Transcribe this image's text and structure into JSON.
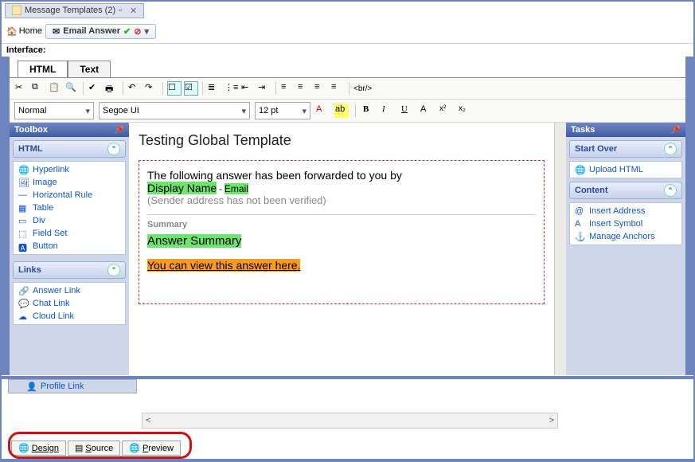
{
  "window": {
    "title": "Message Templates (2)",
    "home": "Home",
    "email_answer": "Email Answer",
    "interface_label": "Interface:"
  },
  "edit_tabs": {
    "html": "HTML",
    "text": "Text"
  },
  "format": {
    "style": "Normal",
    "font": "Segoe UI",
    "size": "12 pt",
    "br_label": "<br/>"
  },
  "toolbox": {
    "title": "Toolbox",
    "html_group": "HTML",
    "html_items": [
      "Hyperlink",
      "Image",
      "Horizontal Rule",
      "Table",
      "Div",
      "Field Set",
      "Button"
    ],
    "links_group": "Links",
    "links_items": [
      "Answer Link",
      "Chat Link",
      "Cloud Link"
    ],
    "extra_item": "Profile Link"
  },
  "tasks": {
    "title": "Tasks",
    "start_over_group": "Start Over",
    "start_over_items": [
      "Upload HTML"
    ],
    "content_group": "Content",
    "content_items": [
      "Insert Address",
      "Insert Symbol",
      "Manage Anchors"
    ]
  },
  "doc": {
    "heading": "Testing Global Template",
    "line1_pre": "The following answer has been forwarded to you by",
    "display_name": "Display Name",
    "dash": " - ",
    "email": "Email",
    "sender_note": "(Sender address has not been verified)",
    "summary_hdr": "Summary",
    "answer_summary": "Answer Summary",
    "view_link": "You can view this answer here."
  },
  "views": {
    "design": "Design",
    "source": "Source",
    "preview": "Preview"
  }
}
